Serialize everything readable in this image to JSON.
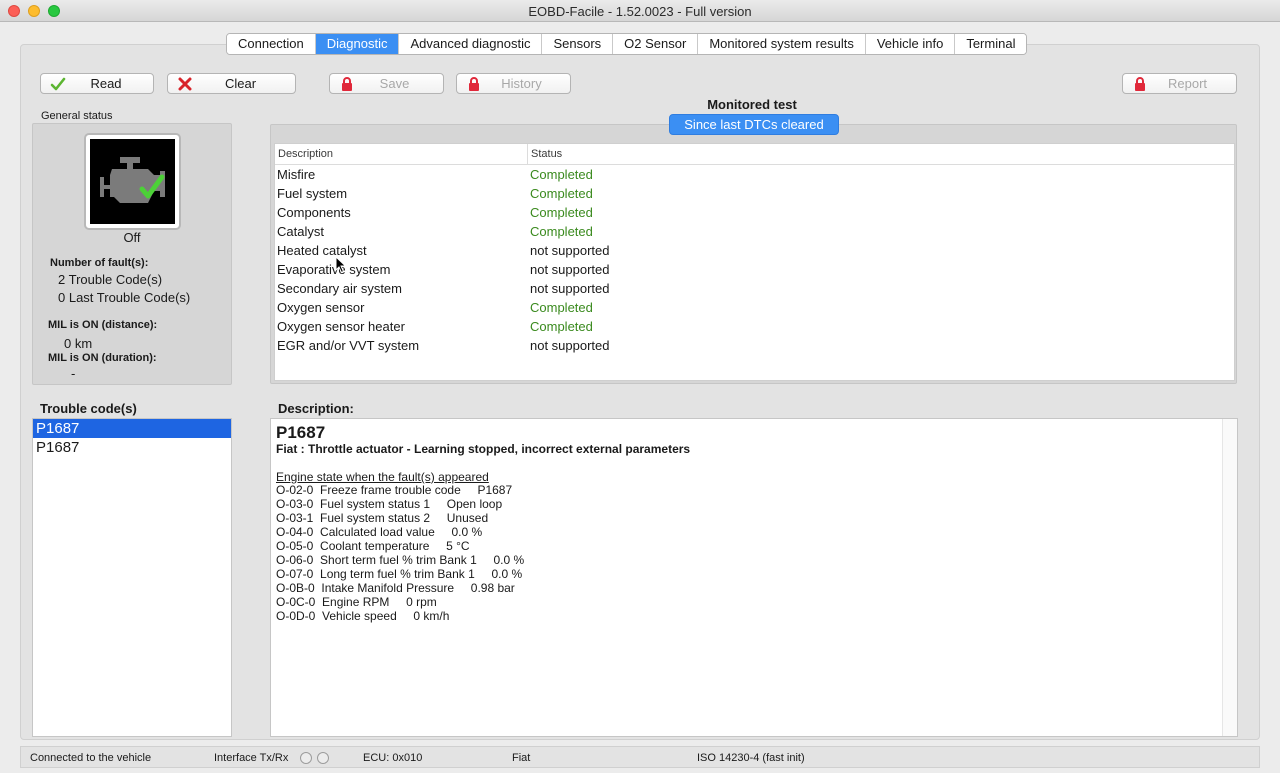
{
  "window": {
    "title": "EOBD-Facile - 1.52.0023 - Full version"
  },
  "tabs": [
    {
      "label": "Connection",
      "active": false
    },
    {
      "label": "Diagnostic",
      "active": true
    },
    {
      "label": "Advanced diagnostic",
      "active": false
    },
    {
      "label": "Sensors",
      "active": false
    },
    {
      "label": "O2 Sensor",
      "active": false
    },
    {
      "label": "Monitored system results",
      "active": false
    },
    {
      "label": "Vehicle info",
      "active": false
    },
    {
      "label": "Terminal",
      "active": false
    }
  ],
  "toolbar": {
    "read": "Read",
    "clear": "Clear",
    "save": "Save",
    "history": "History",
    "report": "Report"
  },
  "general_status": {
    "label": "General status",
    "mil_state": "Off",
    "faults_label": "Number of fault(s):",
    "trouble_codes": "2 Trouble Code(s)",
    "last_trouble_codes": "0 Last Trouble Code(s)",
    "mil_distance_label": "MIL is ON (distance):",
    "mil_distance_value": "0 km",
    "mil_duration_label": "MIL is ON (duration):",
    "mil_duration_value": "-"
  },
  "monitored_test": {
    "title": "Monitored test",
    "segment": "Since last DTCs cleared",
    "columns": {
      "description": "Description",
      "status": "Status"
    },
    "rows": [
      {
        "description": "Misfire",
        "status": "Completed"
      },
      {
        "description": "Fuel system",
        "status": "Completed"
      },
      {
        "description": "Components",
        "status": "Completed"
      },
      {
        "description": "Catalyst",
        "status": "Completed"
      },
      {
        "description": "Heated catalyst",
        "status": "not supported"
      },
      {
        "description": "Evaporative system",
        "status": "not supported"
      },
      {
        "description": "Secondary air system",
        "status": "not supported"
      },
      {
        "description": "Oxygen sensor",
        "status": "Completed"
      },
      {
        "description": "Oxygen sensor heater",
        "status": "Completed"
      },
      {
        "description": "EGR and/or VVT system",
        "status": "not supported"
      }
    ]
  },
  "trouble_codes": {
    "label": "Trouble code(s)",
    "items": [
      {
        "code": "P1687",
        "selected": true
      },
      {
        "code": "P1687",
        "selected": false
      }
    ]
  },
  "description": {
    "label": "Description:",
    "code": "P1687",
    "subtitle": "Fiat : Throttle actuator - Learning stopped, incorrect external parameters",
    "state_heading": "Engine state when the fault(s) appeared",
    "freeze_frame": [
      {
        "pid": "O-02-0",
        "name": "Freeze frame trouble code",
        "value": "P1687"
      },
      {
        "pid": "O-03-0",
        "name": "Fuel system status 1",
        "value": "Open loop"
      },
      {
        "pid": "O-03-1",
        "name": "Fuel system status 2",
        "value": "Unused"
      },
      {
        "pid": "O-04-0",
        "name": "Calculated load value",
        "value": "0.0 %"
      },
      {
        "pid": "O-05-0",
        "name": "Coolant temperature",
        "value": "5 °C"
      },
      {
        "pid": "O-06-0",
        "name": "Short term fuel % trim Bank 1",
        "value": "0.0 %"
      },
      {
        "pid": "O-07-0",
        "name": "Long term fuel % trim Bank 1",
        "value": "0.0 %"
      },
      {
        "pid": "O-0B-0",
        "name": "Intake Manifold Pressure",
        "value": "0.98 bar"
      },
      {
        "pid": "O-0C-0",
        "name": "Engine RPM",
        "value": "0 rpm"
      },
      {
        "pid": "O-0D-0",
        "name": "Vehicle speed",
        "value": "0 km/h"
      }
    ]
  },
  "statusbar": {
    "connection": "Connected to the vehicle",
    "interface": "Interface Tx/Rx",
    "ecu": "ECU: 0x010",
    "make": "Fiat",
    "protocol": "ISO 14230-4 (fast init)"
  },
  "colors": {
    "accent": "#3b8ff3",
    "selection": "#1e65e2",
    "completed": "#3a8a1e",
    "lock": "#e0283a"
  }
}
